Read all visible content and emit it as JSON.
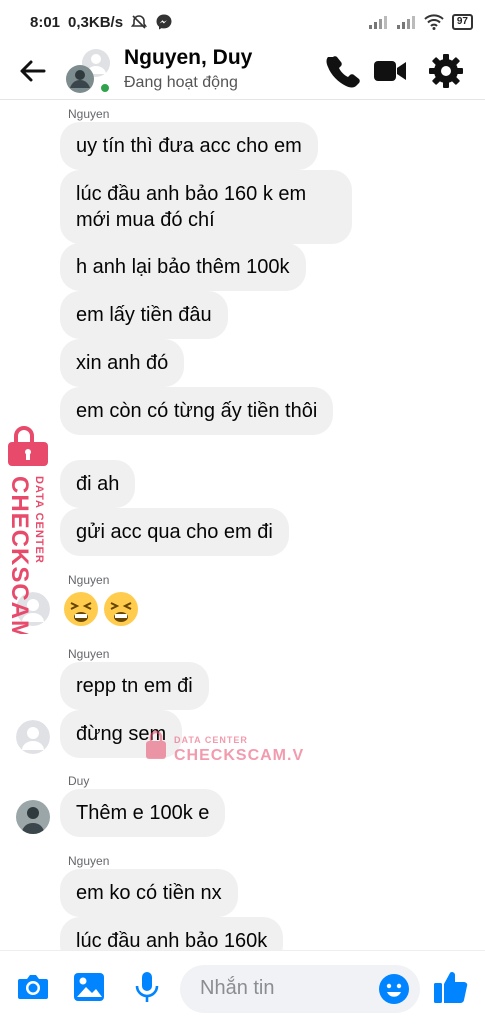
{
  "status_bar": {
    "time": "8:01",
    "speed": "0,3KB/s",
    "battery": "97"
  },
  "header": {
    "name": "Nguyen, Duy",
    "status": "Đang hoạt động"
  },
  "messages": [
    {
      "sender": "Nguyen",
      "text": "uy tín thì đưa acc cho em"
    },
    {
      "text": "lúc đầu anh bảo 160 k em mới mua đó chí"
    },
    {
      "text": "h anh lại bảo thêm 100k"
    },
    {
      "text": "em lấy tiền đâu"
    },
    {
      "text": "xin anh đó"
    },
    {
      "text": "em còn có từng ấy tiền thôi"
    },
    {
      "text": "đi ah"
    },
    {
      "text": "gửi acc qua cho em đi"
    },
    {
      "sender": "Nguyen",
      "text": "😫😫"
    },
    {
      "sender": "Nguyen",
      "text": "repp tn em đi"
    },
    {
      "text": "đừng sem"
    },
    {
      "sender": "Duy",
      "text": "Thêm e 100k e"
    },
    {
      "sender": "Nguyen",
      "text": "em ko có tiền nx"
    },
    {
      "text": "lúc đầu anh bảo 160k"
    }
  ],
  "watermark": {
    "line1": "DATA CENTER",
    "line2": "CHECKSCAM.VN"
  },
  "composer": {
    "placeholder": "Nhắn tin"
  },
  "colors": {
    "accent": "#0084ff",
    "bubble": "#f0f0f0",
    "watermark": "#e84a6b",
    "online": "#31a24c"
  }
}
